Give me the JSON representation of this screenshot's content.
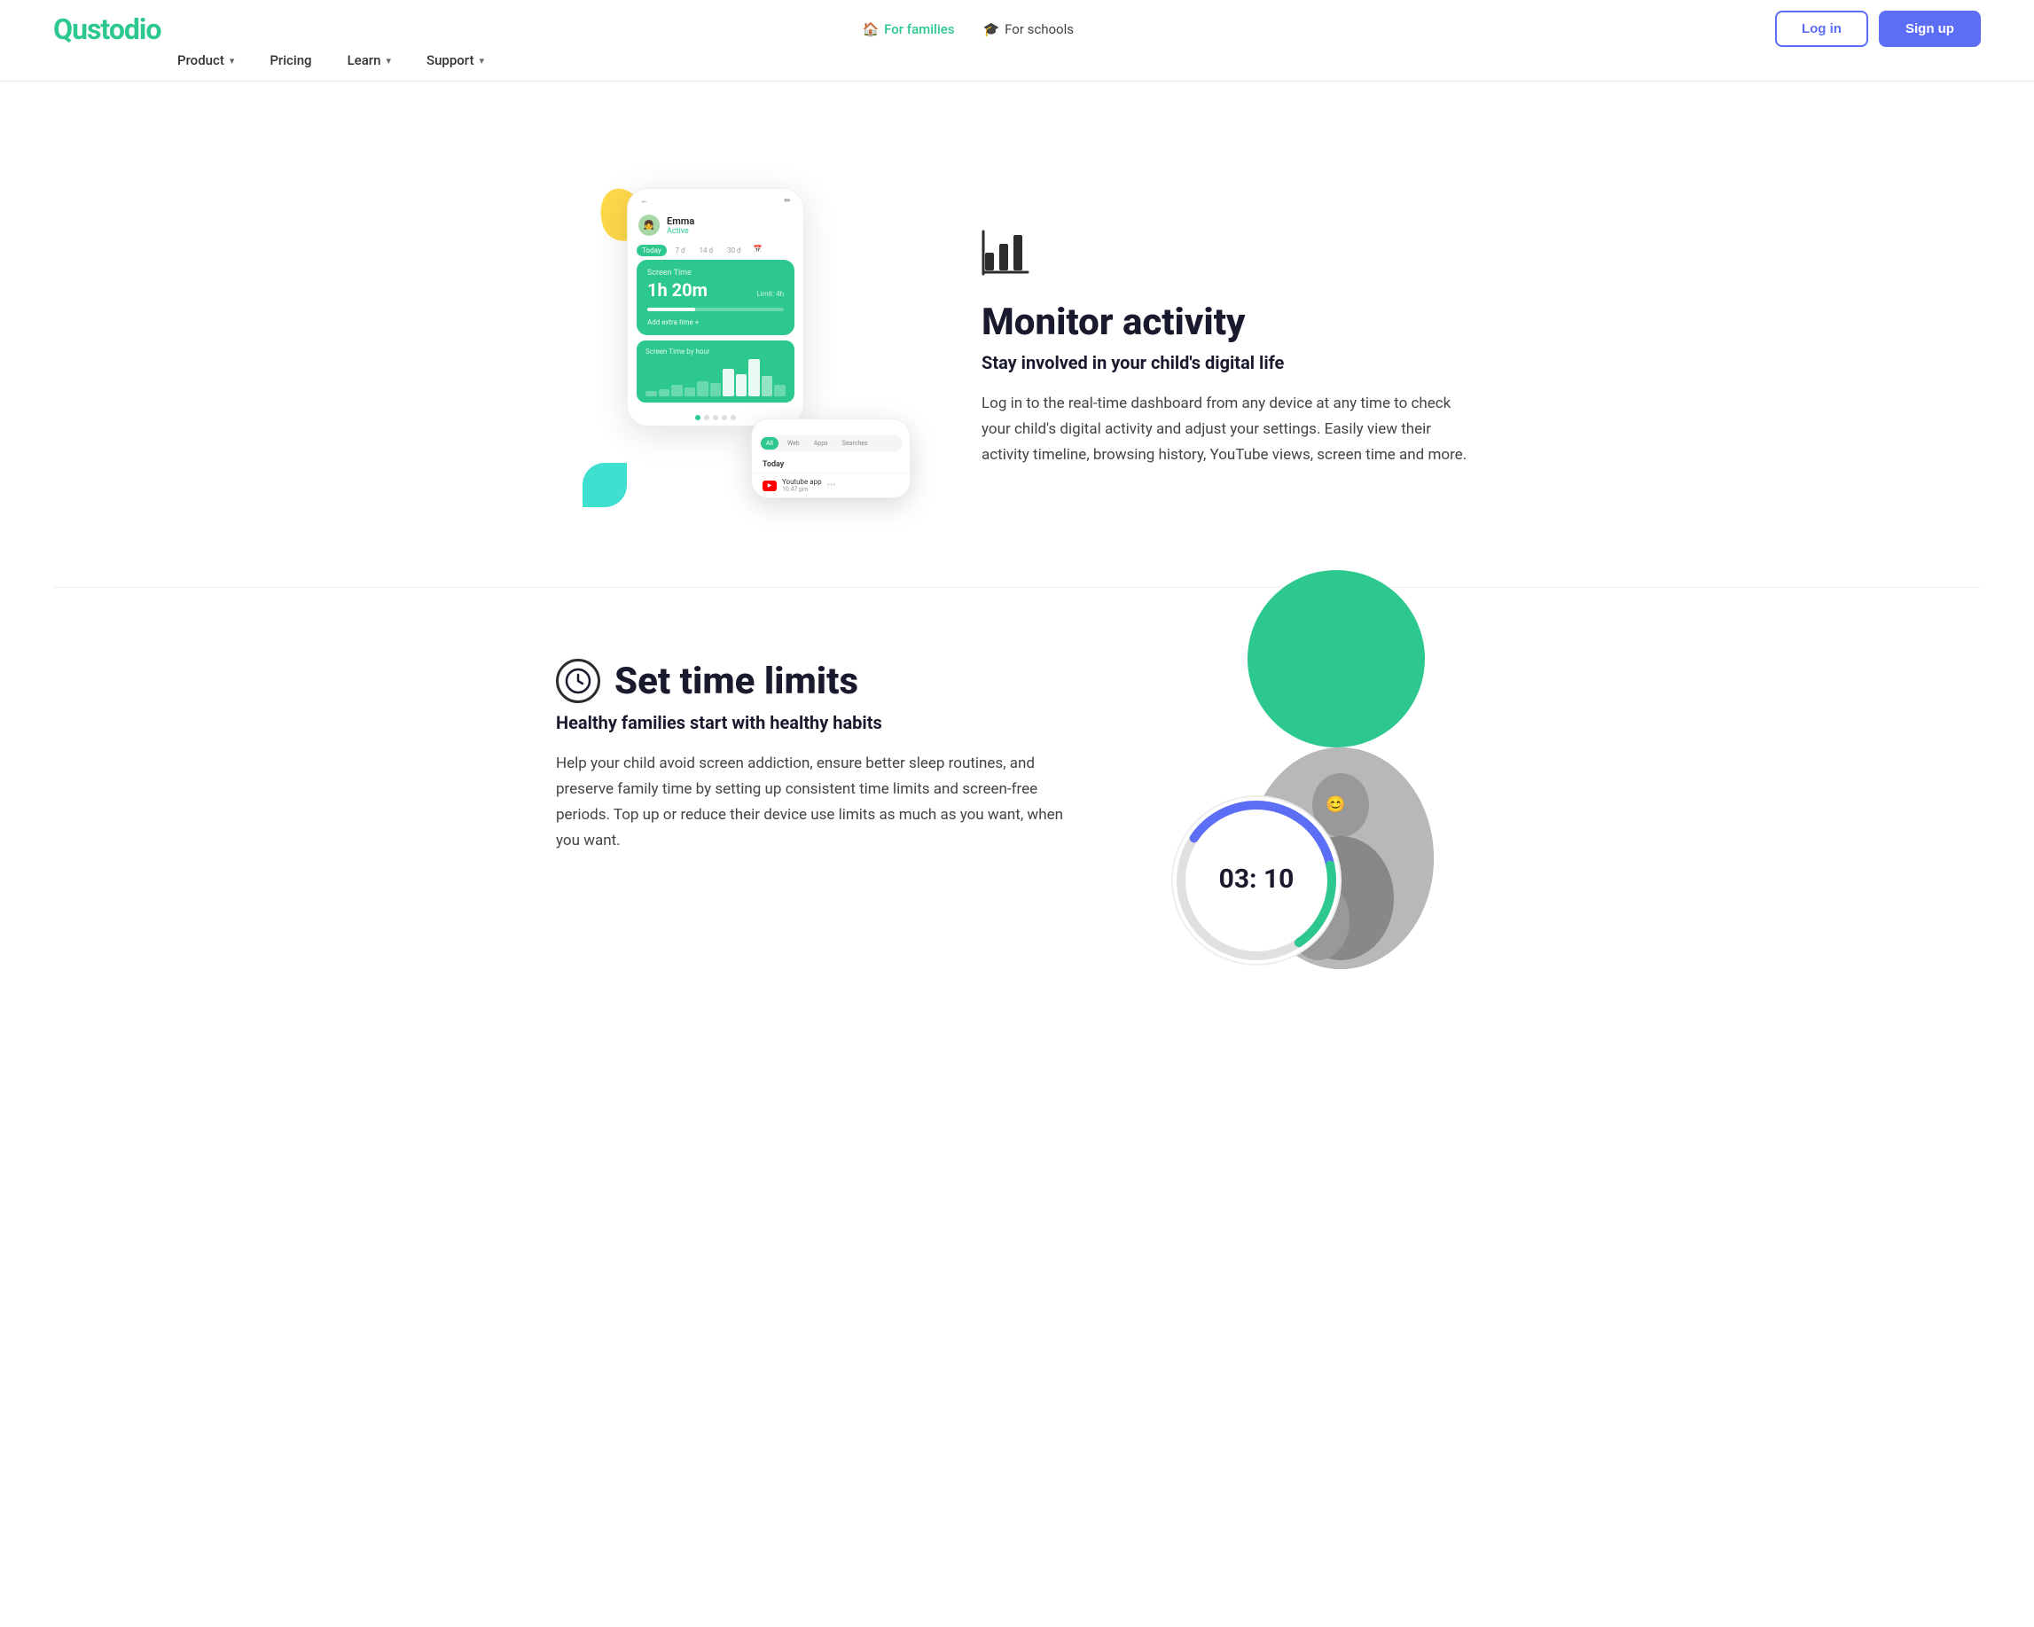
{
  "brand": {
    "logo": "Qustodio",
    "color": "#2dc88d"
  },
  "header": {
    "top_nav": [
      {
        "id": "for-families",
        "label": "For families",
        "active": true,
        "icon": "🏠"
      },
      {
        "id": "for-schools",
        "label": "For schools",
        "active": false,
        "icon": "🎓"
      }
    ],
    "main_nav": [
      {
        "id": "product",
        "label": "Product",
        "has_dropdown": true
      },
      {
        "id": "pricing",
        "label": "Pricing",
        "has_dropdown": false
      },
      {
        "id": "learn",
        "label": "Learn",
        "has_dropdown": true
      },
      {
        "id": "support",
        "label": "Support",
        "has_dropdown": true
      }
    ],
    "buttons": {
      "login": "Log in",
      "signup": "Sign up"
    }
  },
  "section_monitor": {
    "icon": "📊",
    "title": "Monitor activity",
    "subtitle": "Stay involved in your child's digital life",
    "description": "Log in to the real-time dashboard from any device at any time to check your child's digital activity and adjust your settings. Easily view their activity timeline, browsing history, YouTube views, screen time and more.",
    "phone_main": {
      "profile_name": "Emma",
      "profile_status": "Active",
      "date_tabs": [
        "Today",
        "7 d",
        "14 d",
        "30 d"
      ],
      "active_tab": "Today",
      "screen_time_label": "Screen Time",
      "screen_time_value": "1h 20m",
      "screen_time_limit": "Limit: 4h",
      "add_extra": "Add extra time +"
    },
    "phone_secondary": {
      "filter_tabs": [
        "All",
        "Web",
        "Apps",
        "Searches"
      ],
      "active_filter": "All",
      "today_label": "Today",
      "time": "10:47 pm",
      "activity": "Youtube app"
    }
  },
  "section_time": {
    "title": "Set time limits",
    "subtitle": "Healthy families start with healthy habits",
    "description": "Help your child avoid screen addiction, ensure better sleep routines, and preserve family time by setting up consistent time limits and screen-free periods. Top up or reduce their device use limits as much as you want, when you want.",
    "timer_display": "03: 10"
  }
}
